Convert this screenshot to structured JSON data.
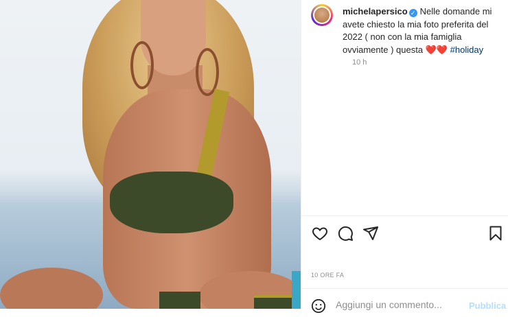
{
  "post": {
    "username": "michelapersico",
    "caption_text": "Nelle domande mi avete chiesto la mia foto preferita del 2022 ( non con la mia famiglia ovviamente ) questa ❤️❤️ ",
    "hashtag": "#holiday",
    "caption_age": "10 h",
    "post_date": "10 ORE FA",
    "comment_placeholder": "Aggiungi un commento...",
    "publish_label": "Pubblica"
  },
  "icons": {
    "verified": "verified-badge-icon",
    "like": "heart-icon",
    "comment": "comment-icon",
    "share": "paper-plane-icon",
    "save": "bookmark-icon",
    "emoji": "emoji-icon"
  },
  "colors": {
    "hashtag": "#00376b",
    "verified": "#3897f0",
    "muted": "#8e8e8e",
    "publish_disabled": "#b2dffc"
  }
}
